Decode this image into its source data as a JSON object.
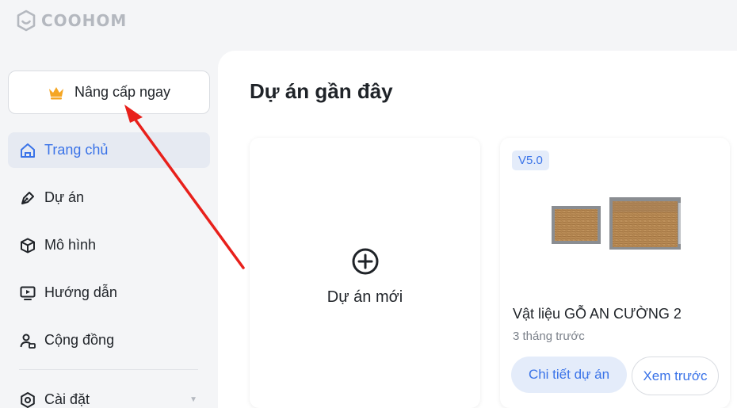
{
  "logo": {
    "text": "COOHOM"
  },
  "sidebar": {
    "upgrade_label": "Nâng cấp ngay",
    "items": [
      {
        "label": "Trang chủ",
        "icon": "home-icon",
        "active": true
      },
      {
        "label": "Dự án",
        "icon": "pen-icon"
      },
      {
        "label": "Mô hình",
        "icon": "cube-icon"
      },
      {
        "label": "Hướng dẫn",
        "icon": "play-screen-icon"
      },
      {
        "label": "Cộng đồng",
        "icon": "community-icon"
      }
    ],
    "settings_label": "Cài đặt"
  },
  "main": {
    "section_title": "Dự án gần đây",
    "new_project_label": "Dự án mới",
    "project": {
      "version": "V5.0",
      "title": "Vật liệu GỖ AN CƯỜNG 2",
      "time": "3 tháng trước",
      "detail_label": "Chi tiết dự án",
      "preview_label": "Xem trước"
    }
  },
  "colors": {
    "accent": "#3a73e8",
    "active_bg": "#e6eaf2",
    "badge_bg": "#e4ecfa",
    "crown": "#f5a623",
    "annotation": "#e8201b"
  }
}
